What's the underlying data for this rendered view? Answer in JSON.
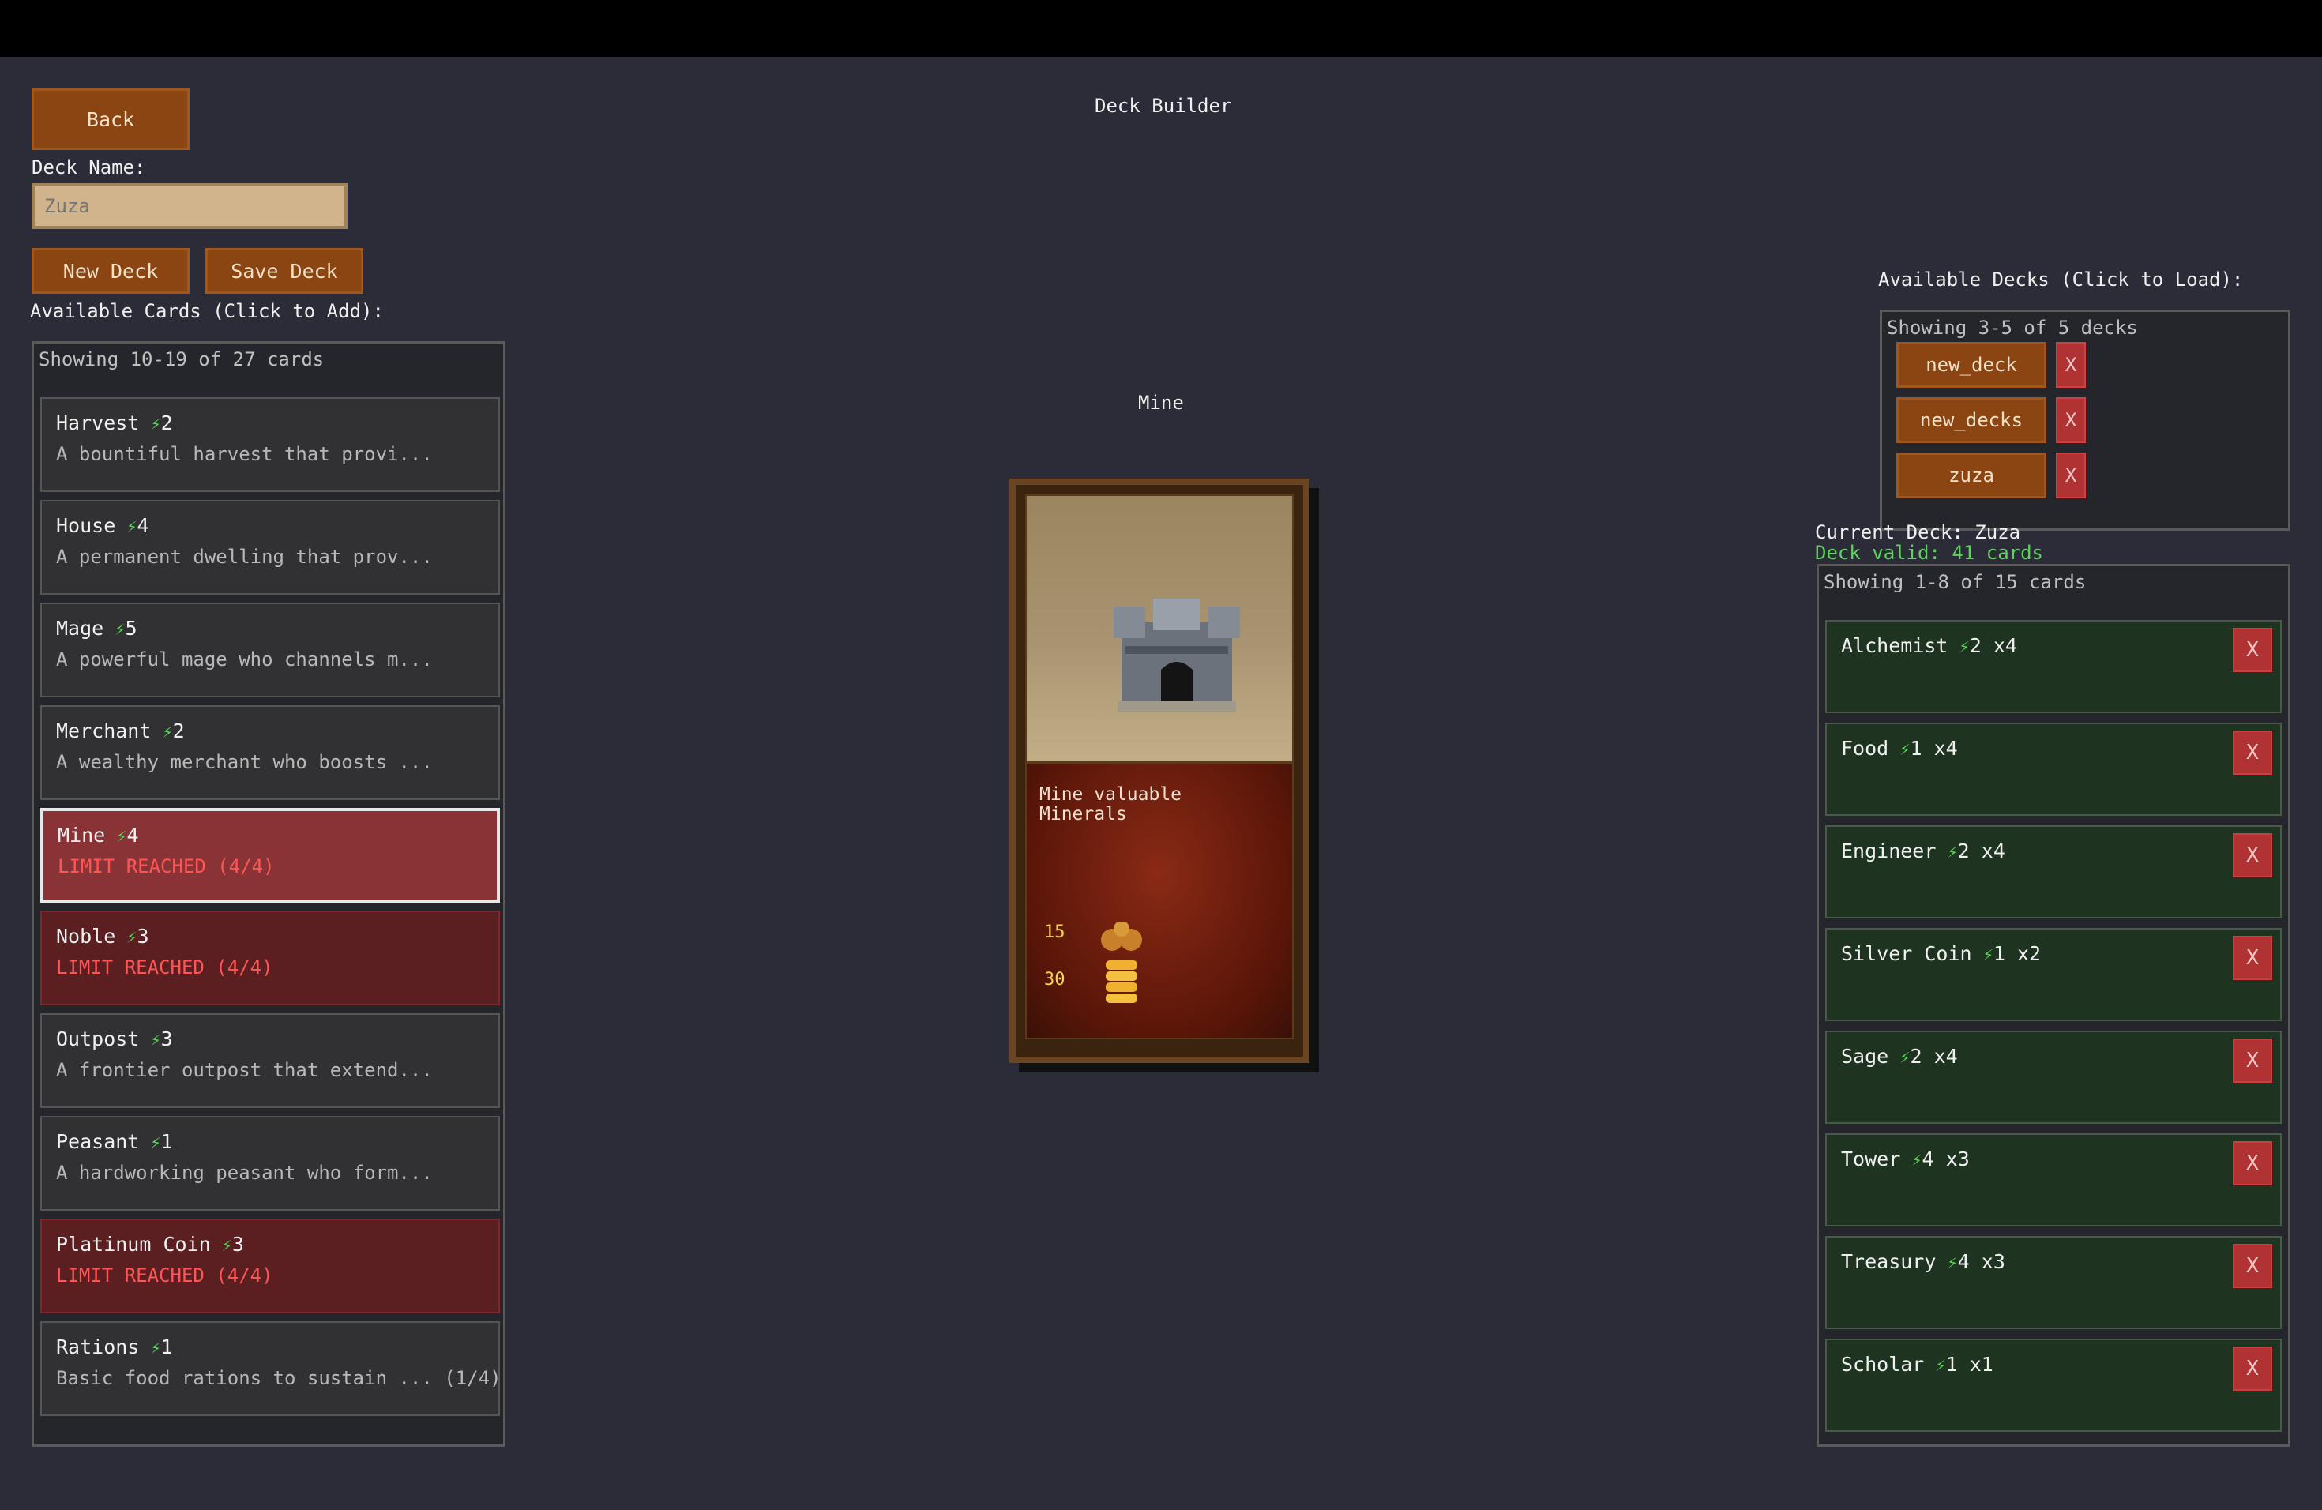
{
  "header": {
    "title": "Deck Builder"
  },
  "controls": {
    "back_label": "Back",
    "deck_name_label": "Deck Name:",
    "deck_name_value": "Zuza",
    "new_deck_label": "New Deck",
    "save_deck_label": "Save Deck"
  },
  "available_cards": {
    "heading": "Available Cards (Click to Add):",
    "showing": "Showing 10-19 of 27 cards",
    "items": [
      {
        "name": "Harvest",
        "cost": "2",
        "desc": "A bountiful harvest that provi...",
        "state": "normal"
      },
      {
        "name": "House",
        "cost": "4",
        "desc": "A permanent dwelling that prov...",
        "state": "normal"
      },
      {
        "name": "Mage",
        "cost": "5",
        "desc": "A powerful mage who channels m...",
        "state": "normal"
      },
      {
        "name": "Merchant",
        "cost": "2",
        "desc": "A wealthy merchant who boosts ...",
        "state": "normal"
      },
      {
        "name": "Mine",
        "cost": "4",
        "desc": "LIMIT REACHED (4/4)",
        "state": "selected"
      },
      {
        "name": "Noble",
        "cost": "3",
        "desc": "LIMIT REACHED (4/4)",
        "state": "limit"
      },
      {
        "name": "Outpost",
        "cost": "3",
        "desc": "A frontier outpost that extend...",
        "state": "normal"
      },
      {
        "name": "Peasant",
        "cost": "1",
        "desc": "A hardworking peasant who form...",
        "state": "normal"
      },
      {
        "name": "Platinum Coin",
        "cost": "3",
        "desc": "LIMIT REACHED (4/4)",
        "state": "limit"
      },
      {
        "name": "Rations",
        "cost": "1",
        "desc": "Basic food rations to sustain ... (1/4)",
        "state": "normal"
      }
    ]
  },
  "preview": {
    "title": "Mine",
    "description": "Mine valuable\nMinerals",
    "stat_top": "15",
    "stat_bottom": "30"
  },
  "available_decks": {
    "heading": "Available Decks (Click to Load):",
    "showing": "Showing 3-5 of 5 decks",
    "items": [
      {
        "name": "new_deck",
        "delete": "X"
      },
      {
        "name": "new_decks",
        "delete": "X"
      },
      {
        "name": "zuza",
        "delete": "X"
      }
    ]
  },
  "current_deck": {
    "label": "Current Deck: Zuza",
    "status": "Deck valid: 41 cards",
    "showing": "Showing 1-8 of 15 cards",
    "items": [
      {
        "name": "Alchemist",
        "cost": "2",
        "count": "x4"
      },
      {
        "name": "Food",
        "cost": "1",
        "count": "x4"
      },
      {
        "name": "Engineer",
        "cost": "2",
        "count": "x4"
      },
      {
        "name": "Silver Coin",
        "cost": "1",
        "count": "x2"
      },
      {
        "name": "Sage",
        "cost": "2",
        "count": "x4"
      },
      {
        "name": "Tower",
        "cost": "4",
        "count": "x3"
      },
      {
        "name": "Treasury",
        "cost": "4",
        "count": "x3"
      },
      {
        "name": "Scholar",
        "cost": "1",
        "count": "x1"
      }
    ],
    "remove_label": "X"
  },
  "colors": {
    "accent_button": "#8b4513",
    "valid_text": "#5fd35f",
    "limit_text": "#ff5555",
    "delete": "#b03232"
  },
  "icons": {
    "cost": "lightning-bolt-icon"
  }
}
